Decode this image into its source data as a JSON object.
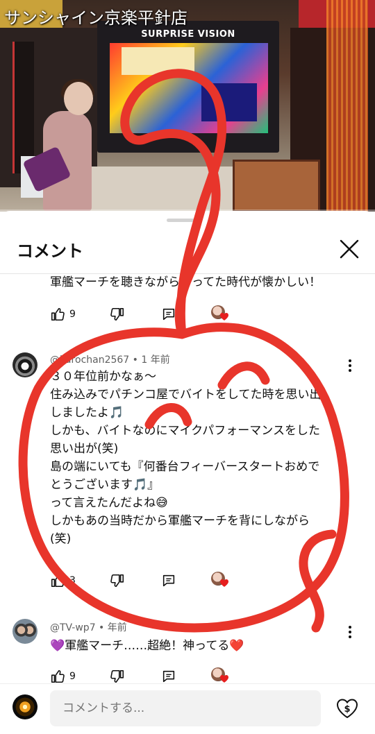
{
  "video": {
    "store_name": "サンシャイン京楽平針店",
    "screen_title": "SURPRISE VISION"
  },
  "sheet": {
    "title": "コメント",
    "close_icon": "close-icon"
  },
  "comments": [
    {
      "body_lines": [
        "軍艦マーチを聴きながら打ってた時代が懐かしい！"
      ],
      "likes": "9"
    },
    {
      "author": "@kurochan2567",
      "time": "1 年前",
      "body_lines": [
        "３０年位前かなぁ〜",
        "住み込みでパチンコ屋でバイトをしてた時を思い出",
        "しましたよ🎵",
        "しかも、バイトなのにマイクパフォーマンスをした",
        "思い出が(笑)",
        "島の端にいても『何番台フィーバースタートおめで",
        "とうございます🎵』",
        "って言えたんだよね😅",
        "しかもあの当時だから軍艦マーチを背にしながら",
        "(笑)"
      ],
      "likes": "3"
    },
    {
      "author": "@TV-wp7",
      "time": "年前",
      "body_lines": [
        "💜軍艦マーチ……超絶！神ってる❤️"
      ],
      "likes": "9"
    }
  ],
  "input": {
    "placeholder": "コメントする..."
  },
  "colors": {
    "annotation_red": "#e8352b",
    "text": "#0f0f0f",
    "meta": "#606060"
  }
}
